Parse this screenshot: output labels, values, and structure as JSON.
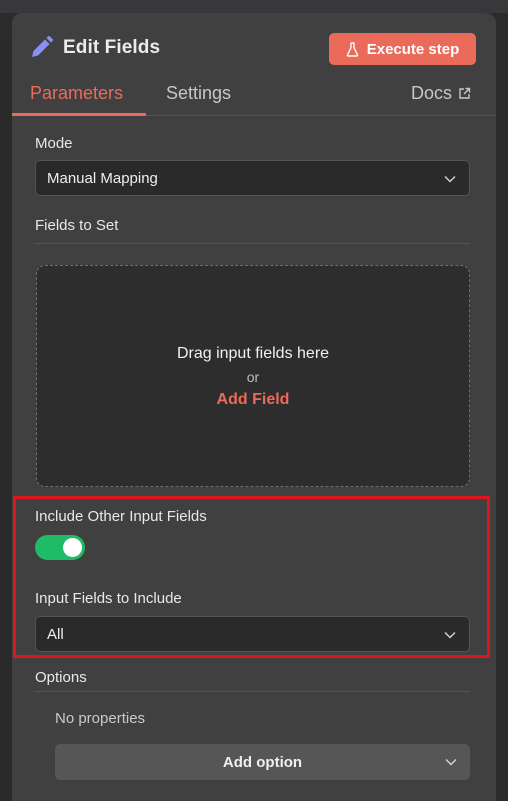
{
  "header": {
    "title": "Edit Fields",
    "execute_label": "Execute step",
    "icon": "pencil-icon"
  },
  "tabs": [
    {
      "label": "Parameters",
      "active": true
    },
    {
      "label": "Settings",
      "active": false
    },
    {
      "label": "Docs",
      "active": false,
      "icon": "external-link-icon"
    }
  ],
  "mode": {
    "label": "Mode",
    "value": "Manual Mapping"
  },
  "fields_to_set": {
    "label": "Fields to Set",
    "drop_text": "Drag input fields here",
    "or_text": "or",
    "add_field": "Add Field"
  },
  "include_other": {
    "label": "Include Other Input Fields",
    "enabled": true
  },
  "input_fields_to_include": {
    "label": "Input Fields to Include",
    "value": "All"
  },
  "options": {
    "label": "Options",
    "empty_text": "No properties",
    "add_option": "Add option"
  },
  "colors": {
    "accent": "#ea6b5a",
    "toggle_on": "#1fbb67",
    "highlight": "#e0141c",
    "panel": "#404041"
  }
}
